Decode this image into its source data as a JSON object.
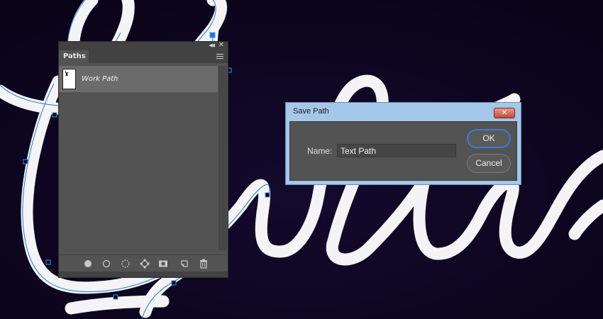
{
  "panel": {
    "tab_label": "Paths",
    "paths": [
      {
        "name": "Work Path"
      }
    ],
    "footer_icons": [
      "fill-path-icon",
      "stroke-path-icon",
      "load-selection-icon",
      "make-work-path-icon",
      "add-mask-icon",
      "new-path-icon",
      "delete-icon"
    ]
  },
  "dialog": {
    "title": "Save Path",
    "close_label": "✕",
    "name_label": "Name:",
    "name_value": "Text Path",
    "ok_label": "OK",
    "cancel_label": "Cancel"
  },
  "colors": {
    "canvas": "#0d061f",
    "panel": "#535353",
    "selected_row": "#6b6b6b",
    "path_stroke": "#1f78d1",
    "dialog_frame": "#a4c7ea",
    "ok_focus": "#3b7cd6"
  }
}
